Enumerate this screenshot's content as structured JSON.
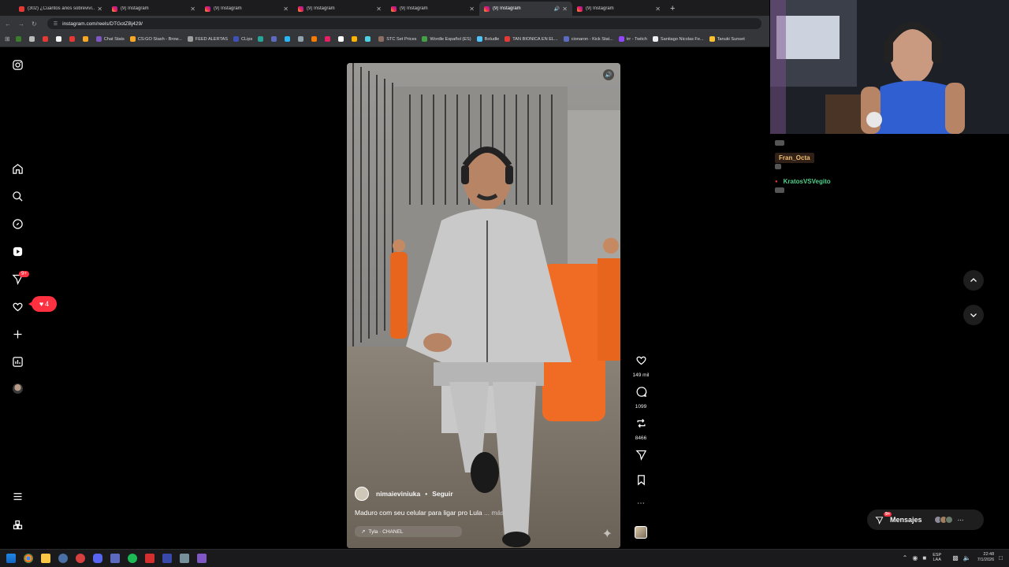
{
  "browser": {
    "tabs": [
      {
        "title": "(302) ¿Cuántos años sobreviví...",
        "kind": "yt",
        "active": false
      },
      {
        "title": "(9) Instagram",
        "kind": "ig",
        "active": false
      },
      {
        "title": "(9) Instagram",
        "kind": "ig",
        "active": false
      },
      {
        "title": "(9) Instagram",
        "kind": "ig",
        "active": false
      },
      {
        "title": "(9) Instagram",
        "kind": "ig",
        "active": false
      },
      {
        "title": "(9) Instagram",
        "kind": "ig",
        "active": true
      },
      {
        "title": "(9) Instagram",
        "kind": "ig",
        "active": false
      }
    ],
    "url": "instagram.com/reels/DTGotZBj429/",
    "bookmarks": [
      {
        "label": "",
        "color": "#3a7d2c"
      },
      {
        "label": "",
        "color": "#bbbbbb"
      },
      {
        "label": "",
        "color": "#e53935"
      },
      {
        "label": "",
        "color": "#f5f5f5"
      },
      {
        "label": "",
        "color": "#e53935"
      },
      {
        "label": "",
        "color": "#f9a825"
      },
      {
        "label": "Chat Stats",
        "color": "#7e57c2"
      },
      {
        "label": "CS:GO Stash - Brow...",
        "color": "#f9a825"
      },
      {
        "label": "FEED ALERTAS",
        "color": "#9e9e9e"
      },
      {
        "label": "CLips",
        "color": "#3f51b5"
      },
      {
        "label": "",
        "color": "#26a69a"
      },
      {
        "label": "",
        "color": "#5c6bc0"
      },
      {
        "label": "",
        "color": "#29b6f6"
      },
      {
        "label": "",
        "color": "#90a4ae"
      },
      {
        "label": "",
        "color": "#f57c00"
      },
      {
        "label": "",
        "color": "#e91e63"
      },
      {
        "label": "",
        "color": "#ffffff"
      },
      {
        "label": "",
        "color": "#ffb300"
      },
      {
        "label": "",
        "color": "#4dd0e1"
      },
      {
        "label": "STC Set Prices",
        "color": "#8d6e63"
      },
      {
        "label": "Wordle Español (ES)",
        "color": "#43a047"
      },
      {
        "label": "Boludle",
        "color": "#4fc3f7"
      },
      {
        "label": "TAN BIONICA EN EL...",
        "color": "#e53935"
      },
      {
        "label": "cionaron - Kick Stat...",
        "color": "#5c6bc0"
      },
      {
        "label": "trr - Twitch",
        "color": "#9146ff"
      },
      {
        "label": "Santiago Nicolas Fe...",
        "color": "#eeeeee"
      },
      {
        "label": "Tanuki Sunset",
        "color": "#fbc02d"
      }
    ]
  },
  "instagram": {
    "nav_badge_notifications": "9+",
    "likes_pill_count": "4",
    "reel": {
      "username": "nimaieviniuka",
      "follow_label": "Seguir",
      "caption": "Maduro com seu celular para ligar pro Lula",
      "more_label": "... más",
      "audio": "Tyla · CHANEL",
      "likes": "149 mil",
      "comments": "1099",
      "reposts": "8466"
    },
    "messages": {
      "label": "Mensajes",
      "badge": "9+"
    }
  },
  "stream_chat": {
    "lines": [
      {
        "name": "Fran_Octa",
        "style": "orange"
      },
      {
        "name": "KratosVSVegito",
        "style": "green"
      }
    ]
  },
  "taskbar": {
    "lang_top": "ESP",
    "lang_bottom": "LAA",
    "time": "22:48",
    "date": "7/1/2026"
  }
}
